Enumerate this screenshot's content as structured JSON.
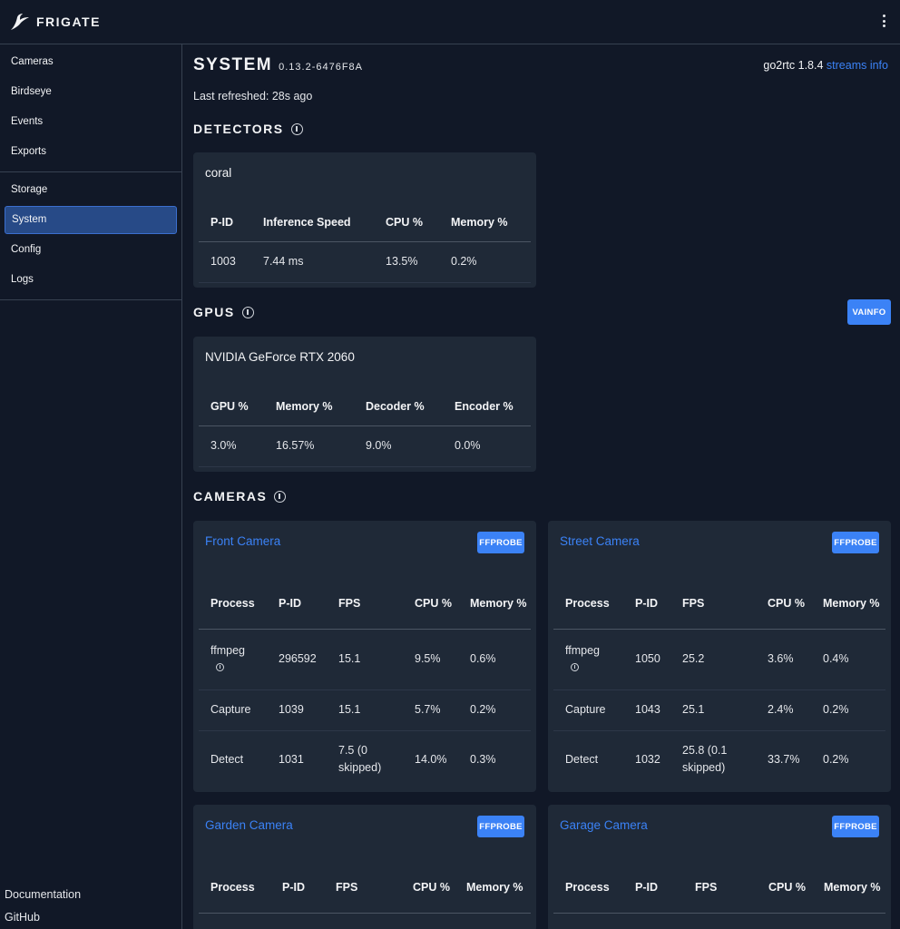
{
  "app": {
    "name": "FRIGATE"
  },
  "sidebar": {
    "items": [
      {
        "label": "Cameras"
      },
      {
        "label": "Birdseye"
      },
      {
        "label": "Events"
      },
      {
        "label": "Exports"
      },
      {
        "label": "Storage"
      },
      {
        "label": "System"
      },
      {
        "label": "Config"
      },
      {
        "label": "Logs"
      }
    ],
    "active": "System",
    "footer": {
      "documentation": "Documentation",
      "github": "GitHub"
    }
  },
  "page": {
    "title": "SYSTEM",
    "version": "0.13.2-6476F8A",
    "go2rtc_text": "go2rtc 1.8.4",
    "streams_info_link": "streams info",
    "last_refreshed": "Last refreshed: 28s ago"
  },
  "detectors": {
    "heading": "DETECTORS",
    "card_title": "coral",
    "headers": [
      "P-ID",
      "Inference Speed",
      "CPU %",
      "Memory %"
    ],
    "rows": [
      [
        "1003",
        "7.44 ms",
        "13.5%",
        "0.2%"
      ]
    ]
  },
  "gpus": {
    "heading": "GPUS",
    "vainfo_button": "VAINFO",
    "card_title": "NVIDIA GeForce RTX 2060",
    "headers": [
      "GPU %",
      "Memory %",
      "Decoder %",
      "Encoder %"
    ],
    "rows": [
      [
        "3.0%",
        "16.57%",
        "9.0%",
        "0.0%"
      ]
    ]
  },
  "cameras": {
    "heading": "CAMERAS",
    "ffprobe_button": "FFPROBE",
    "headers": [
      "Process",
      "P-ID",
      "FPS",
      "CPU %",
      "Memory %"
    ],
    "list": [
      {
        "name": "Front Camera",
        "rows": [
          [
            "ffmpeg",
            "296592",
            "15.1",
            "9.5%",
            "0.6%"
          ],
          [
            "Capture",
            "1039",
            "15.1",
            "5.7%",
            "0.2%"
          ],
          [
            "Detect",
            "1031",
            "7.5 (0 skipped)",
            "14.0%",
            "0.3%"
          ]
        ]
      },
      {
        "name": "Street Camera",
        "rows": [
          [
            "ffmpeg",
            "1050",
            "25.2",
            "3.6%",
            "0.4%"
          ],
          [
            "Capture",
            "1043",
            "25.1",
            "2.4%",
            "0.2%"
          ],
          [
            "Detect",
            "1032",
            "25.8 (0.1 skipped)",
            "33.7%",
            "0.2%"
          ]
        ]
      },
      {
        "name": "Garden Camera",
        "rows": []
      },
      {
        "name": "Garage Camera",
        "rows": []
      }
    ]
  }
}
